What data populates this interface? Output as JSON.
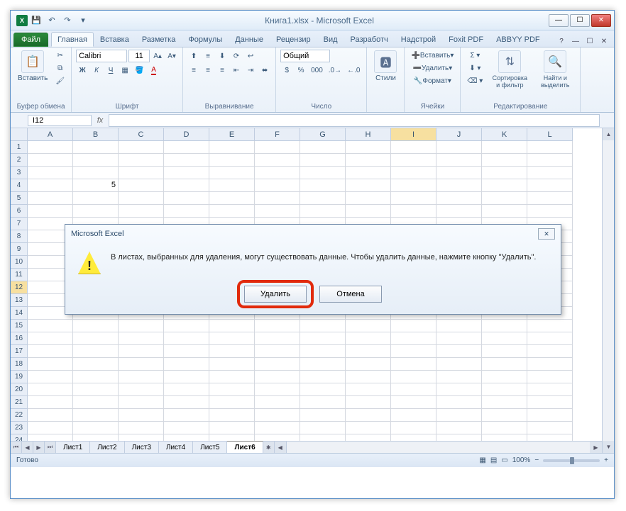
{
  "window": {
    "title": "Книга1.xlsx - Microsoft Excel"
  },
  "qat": {
    "save": "💾",
    "undo": "↶",
    "redo": "↷"
  },
  "tabs": {
    "file": "Файл",
    "items": [
      "Главная",
      "Вставка",
      "Разметка",
      "Формулы",
      "Данные",
      "Рецензир",
      "Вид",
      "Разработч",
      "Надстрой",
      "Foxit PDF",
      "ABBYY PDF"
    ],
    "active_index": 0
  },
  "ribbon": {
    "clipboard": {
      "paste": "Вставить",
      "label": "Буфер обмена"
    },
    "font": {
      "name": "Calibri",
      "size": "11",
      "bold": "Ж",
      "italic": "К",
      "underline": "Ч",
      "label": "Шрифт"
    },
    "alignment": {
      "label": "Выравнивание"
    },
    "number": {
      "format": "Общий",
      "label": "Число"
    },
    "styles": {
      "btn": "Стили",
      "label": ""
    },
    "cells": {
      "insert": "Вставить",
      "delete": "Удалить",
      "format": "Формат",
      "label": "Ячейки"
    },
    "editing": {
      "sort": "Сортировка и фильтр",
      "find": "Найти и выделить",
      "label": "Редактирование"
    }
  },
  "formula_bar": {
    "namebox": "I12",
    "fx": "fx",
    "value": ""
  },
  "grid": {
    "columns": [
      "A",
      "B",
      "C",
      "D",
      "E",
      "F",
      "G",
      "H",
      "I",
      "J",
      "K",
      "L"
    ],
    "active_col_index": 8,
    "row_count": 24,
    "active_row": 12,
    "data": {
      "B4": "5"
    }
  },
  "sheets": {
    "navs": [
      "⏮",
      "◀",
      "▶",
      "⏭"
    ],
    "tabs": [
      "Лист1",
      "Лист2",
      "Лист3",
      "Лист4",
      "Лист5",
      "Лист6"
    ],
    "active_index": 5,
    "new_icon": "✱"
  },
  "status": {
    "ready": "Готово",
    "zoom": "100%",
    "minus": "−",
    "plus": "+"
  },
  "dialog": {
    "title": "Microsoft Excel",
    "message": "В листах, выбранных для удаления, могут существовать данные. Чтобы удалить данные, нажмите кнопку \"Удалить\".",
    "ok": "Удалить",
    "cancel": "Отмена",
    "warn": "!"
  }
}
